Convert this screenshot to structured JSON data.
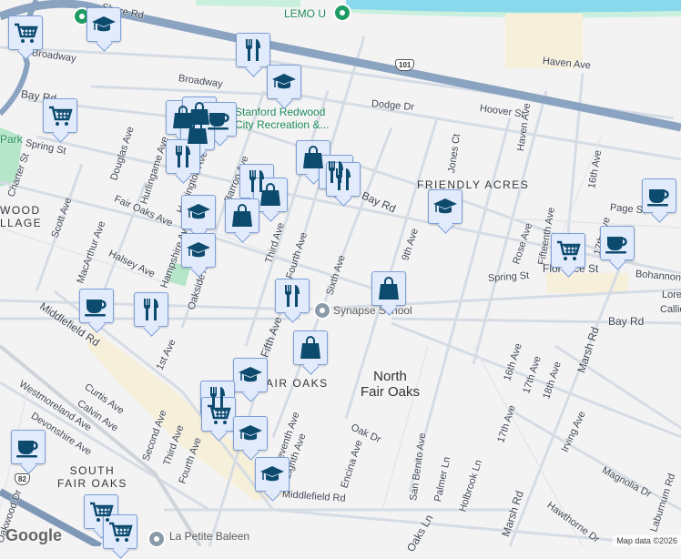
{
  "map": {
    "streets": [
      "Shore Rd",
      "Broadway",
      "Broadway",
      "Bay Rd",
      "Spring St",
      "Charter St",
      "Douglas Ave",
      "Hurlingame Ave",
      "Harrington Ave",
      "Barron Ave",
      "Fair Oaks Ave",
      "Scott Ave",
      "Halsey Ave",
      "MacArthur Ave",
      "Hampshire Ave",
      "Oakside Ave",
      "Third Ave",
      "Fourth Ave",
      "Sixth Ave",
      "Dodge Dr",
      "Hoover St",
      "Haven Ave",
      "Haven Ave",
      "Jones Ct",
      "16th Ave",
      "9th Ave",
      "Rose Ave",
      "Fifteenth Ave",
      "17th Ave",
      "Page St",
      "Florence St",
      "Bohannon",
      "Spring St",
      "Bay Rd",
      "Middlefield Rd",
      "Fifth Ave",
      "1st Ave",
      "Curtis Ave",
      "Calvin Ave",
      "Westmoreland Ave",
      "Devonshire Ave",
      "Second Ave",
      "Third Ave",
      "Fourth Ave",
      "Seventh Ave",
      "Eighth Ave",
      "Middlefield Rd",
      "Oak Dr",
      "Encina Ave",
      "San Benito Ave",
      "Palmer Ln",
      "Holbrook Ln",
      "16th Ave",
      "17th Ave",
      "18th Ave",
      "17th Ave",
      "Marsh Rd",
      "Marsh Rd",
      "Irving Ave",
      "Magnolia Dr",
      "Hawthorne Dr",
      "Laburnum Rd",
      "Oaks Ln",
      "Lore",
      "Callie",
      "Oakwood Dr",
      "Bay Rd"
    ],
    "areas": {
      "redwood_village": "WOOD\nLLAGE",
      "friendly_acres": "FRIENDLY ACRES",
      "fair_oaks": "AIR OAKS",
      "south_fair_oaks": "SOUTH\nFAIR OAKS",
      "north_fair_oaks": "North\nFair Oaks"
    },
    "pois": {
      "lemo": "LEMO U",
      "stanford": "Stanford Redwood\nCity Recreation &...",
      "synapse": "Synapse School",
      "petite": "La Petite Baleen",
      "park": "Park"
    },
    "highways": [
      "101",
      "82"
    ],
    "markers": [
      "cart",
      "graduation-cap",
      "restaurant",
      "graduation-cap",
      "cart",
      "shopping-bag",
      "shopping-bag",
      "coffee",
      "shopping-bag",
      "restaurant",
      "shopping-bag",
      "restaurant",
      "restaurant",
      "restaurant",
      "shopping-bag",
      "shopping-bag",
      "graduation-cap",
      "graduation-cap",
      "graduation-cap",
      "coffee",
      "coffee",
      "cart",
      "shopping-bag",
      "restaurant",
      "coffee",
      "restaurant",
      "shopping-bag",
      "graduation-cap",
      "restaurant",
      "cart",
      "graduation-cap",
      "graduation-cap",
      "coffee",
      "cart",
      "cart"
    ],
    "logo": "Google",
    "attribution": "Map data ©2026"
  },
  "colors": {
    "marker_bg": "#e2ebfb",
    "marker_icon": "#0c4a6e",
    "highway": "#8aa3c0",
    "water": "#8ad8ec",
    "park": "#b5e6c9"
  }
}
